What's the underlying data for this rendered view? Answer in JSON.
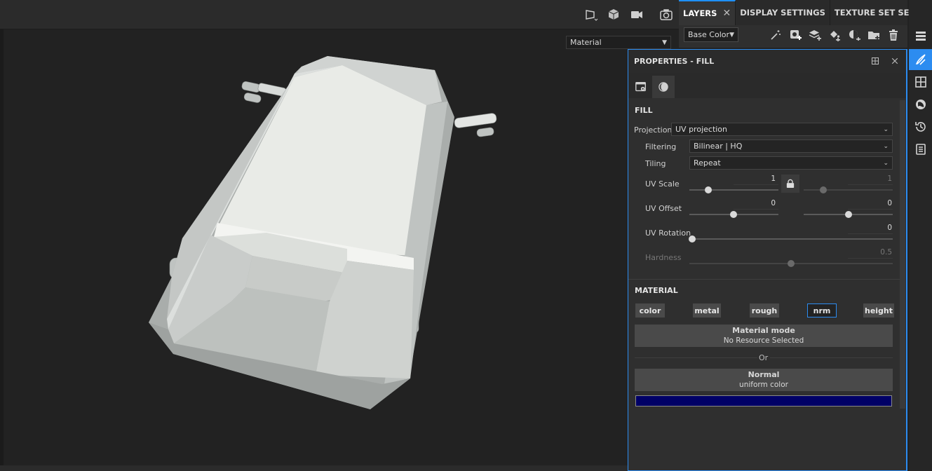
{
  "viewport": {
    "view_mode": "Material",
    "toolbar_icons": [
      "perspective-camera-icon",
      "cube-view-icon",
      "video-camera-icon",
      "screenshot-camera-icon"
    ]
  },
  "tabs": [
    {
      "label": "LAYERS",
      "active": true,
      "closable": true
    },
    {
      "label": "DISPLAY SETTINGS",
      "active": false
    },
    {
      "label": "TEXTURE SET SETTINGS",
      "active": false
    }
  ],
  "layers_toolbar": {
    "channel": "Base Color",
    "icons": [
      "magic-wand-icon",
      "add-mask-icon",
      "add-layer-icon",
      "add-fill-layer-icon",
      "add-effect-icon",
      "add-folder-icon",
      "delete-icon"
    ]
  },
  "properties": {
    "title": "PROPERTIES - FILL",
    "fill": {
      "section": "FILL",
      "projection_label": "Projection",
      "projection_value": "UV projection",
      "filtering_label": "Filtering",
      "filtering_value": "Bilinear | HQ",
      "tiling_label": "Tiling",
      "tiling_value": "Repeat",
      "uv_scale_label": "UV Scale",
      "uv_scale_u": "1",
      "uv_scale_v": "1",
      "uv_offset_label": "UV Offset",
      "uv_offset_u": "0",
      "uv_offset_v": "0",
      "uv_rotation_label": "UV Rotation",
      "uv_rotation_value": "0",
      "hardness_label": "Hardness",
      "hardness_value": "0.5"
    },
    "material": {
      "section": "MATERIAL",
      "channels": [
        "color",
        "metal",
        "rough",
        "nrm",
        "height"
      ],
      "selected_channel": "nrm",
      "mode_title": "Material mode",
      "mode_value": "No Resource Selected",
      "or_label": "Or",
      "normal_title": "Normal",
      "normal_value": "uniform color",
      "normal_color": "#000066"
    }
  },
  "sidebar": {
    "icons": [
      "layer-stack-icon",
      "brush-properties-icon",
      "texture-set-grid-icon",
      "environment-icon",
      "history-icon",
      "log-icon"
    ],
    "active": "brush-properties-icon"
  }
}
